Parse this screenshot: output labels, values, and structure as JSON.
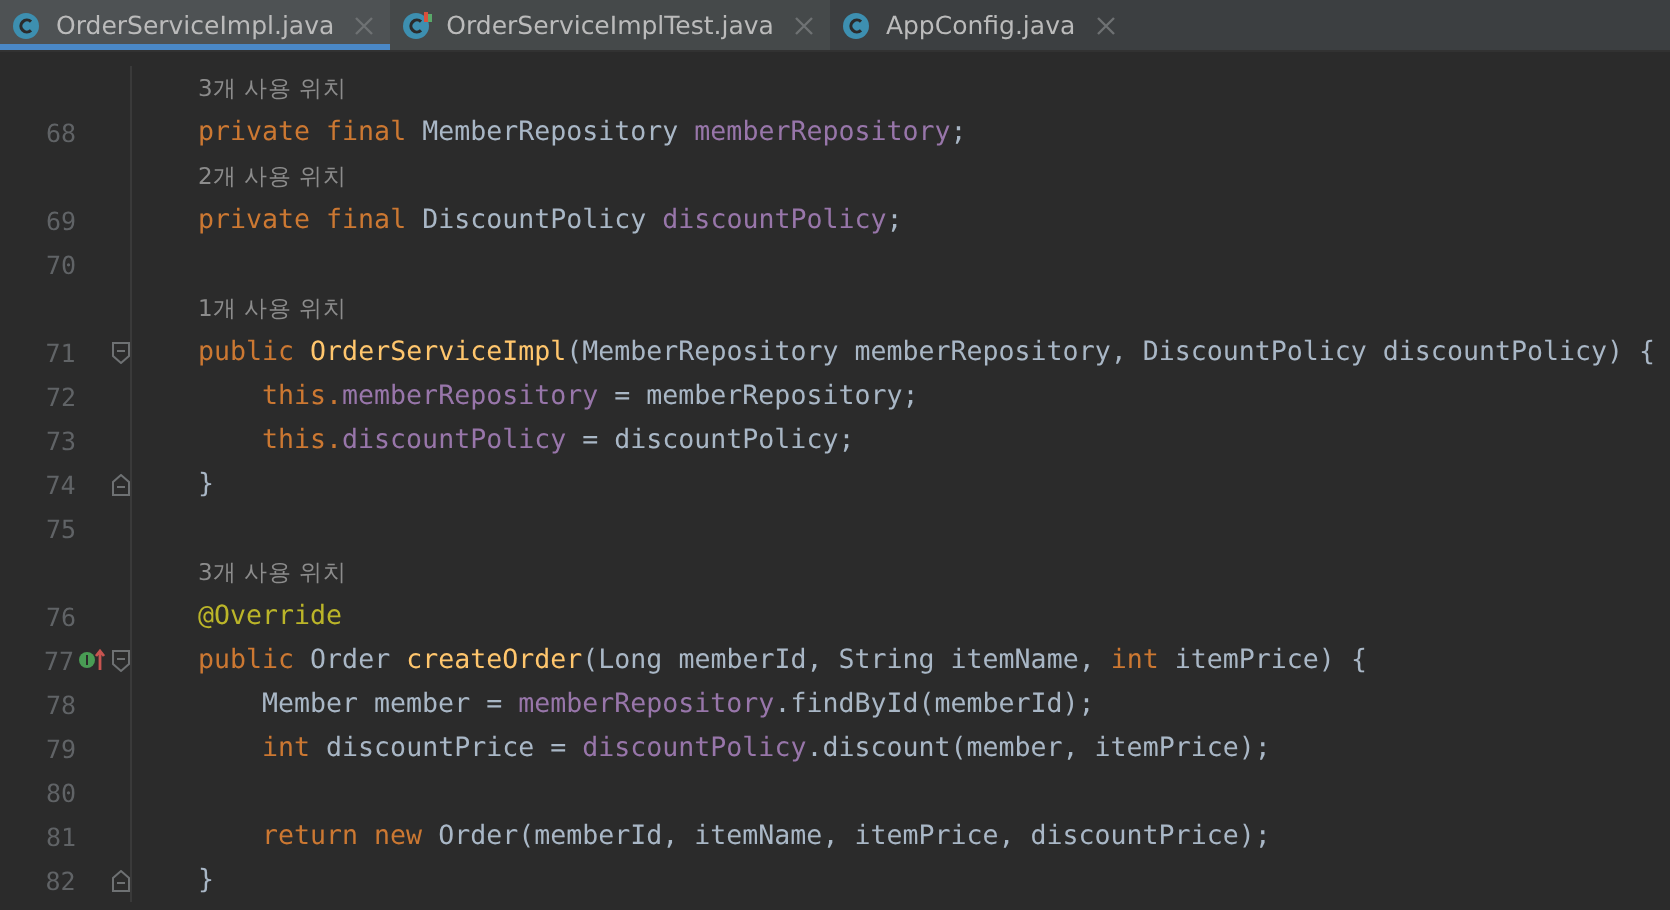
{
  "tabs": [
    {
      "label": "OrderServiceImpl.java",
      "selected": true,
      "kind": "class"
    },
    {
      "label": "OrderServiceImplTest.java",
      "selected": false,
      "kind": "test"
    },
    {
      "label": "AppConfig.java",
      "selected": false,
      "kind": "class"
    }
  ],
  "lines": [
    {
      "kind": "hint",
      "text": "3개 사용 위치"
    },
    {
      "kind": "code",
      "number": "68",
      "parts": [
        {
          "kind": "keyword",
          "text": "private final "
        },
        {
          "kind": "plain",
          "text": "MemberRepository "
        },
        {
          "kind": "field",
          "text": "memberRepository"
        },
        {
          "kind": "plain",
          "text": ";"
        }
      ]
    },
    {
      "kind": "hint",
      "text": "2개 사용 위치"
    },
    {
      "kind": "code",
      "number": "69",
      "parts": [
        {
          "kind": "keyword",
          "text": "private final "
        },
        {
          "kind": "plain",
          "text": "DiscountPolicy "
        },
        {
          "kind": "field",
          "text": "discountPolicy"
        },
        {
          "kind": "plain",
          "text": ";"
        }
      ]
    },
    {
      "kind": "code",
      "number": "70"
    },
    {
      "kind": "hint",
      "text": "1개 사용 위치"
    },
    {
      "kind": "code",
      "number": "71",
      "fold_start": true,
      "parts": [
        {
          "kind": "keyword",
          "text": "public "
        },
        {
          "kind": "declaration",
          "text": "OrderServiceImpl"
        },
        {
          "kind": "plain",
          "text": "(MemberRepository memberRepository, DiscountPolicy discountPolicy) {"
        }
      ]
    },
    {
      "kind": "code",
      "number": "72",
      "indented": true,
      "parts": [
        {
          "kind": "keyword",
          "text": "this."
        },
        {
          "kind": "field",
          "text": "memberRepository"
        },
        {
          "kind": "plain",
          "text": " = memberRepository;"
        }
      ]
    },
    {
      "kind": "code",
      "number": "73",
      "indented": true,
      "parts": [
        {
          "kind": "keyword",
          "text": "this."
        },
        {
          "kind": "field",
          "text": "discountPolicy"
        },
        {
          "kind": "plain",
          "text": " = discountPolicy;"
        }
      ]
    },
    {
      "kind": "code",
      "number": "74",
      "fold_end": true,
      "parts": [
        {
          "kind": "plain",
          "text": "}"
        }
      ]
    },
    {
      "kind": "code",
      "number": "75"
    },
    {
      "kind": "hint",
      "text": "3개 사용 위치"
    },
    {
      "kind": "code",
      "number": "76",
      "parts": [
        {
          "kind": "annotation",
          "text": "@Override"
        }
      ]
    },
    {
      "kind": "code",
      "number": "77",
      "fold_start": true,
      "implements_marker": true,
      "parts": [
        {
          "kind": "keyword",
          "text": "public "
        },
        {
          "kind": "plain",
          "text": "Order "
        },
        {
          "kind": "declaration",
          "text": "createOrder"
        },
        {
          "kind": "plain",
          "text": "(Long memberId, String itemName, "
        },
        {
          "kind": "keyword",
          "text": "int"
        },
        {
          "kind": "plain",
          "text": " itemPrice) {"
        }
      ]
    },
    {
      "kind": "code",
      "number": "78",
      "indented": true,
      "parts": [
        {
          "kind": "plain",
          "text": "Member member = "
        },
        {
          "kind": "field",
          "text": "memberRepository"
        },
        {
          "kind": "plain",
          "text": ".findById(memberId);"
        }
      ]
    },
    {
      "kind": "code",
      "number": "79",
      "indented": true,
      "parts": [
        {
          "kind": "keyword",
          "text": "int"
        },
        {
          "kind": "plain",
          "text": " discountPrice = "
        },
        {
          "kind": "field",
          "text": "discountPolicy"
        },
        {
          "kind": "plain",
          "text": ".discount(member, itemPrice);"
        }
      ]
    },
    {
      "kind": "code",
      "number": "80"
    },
    {
      "kind": "code",
      "number": "81",
      "indented": true,
      "parts": [
        {
          "kind": "keyword",
          "text": "return new "
        },
        {
          "kind": "plain",
          "text": "Order(memberId, itemName, itemPrice, discountPrice);"
        }
      ]
    },
    {
      "kind": "code",
      "number": "82",
      "fold_end": true,
      "parts": [
        {
          "kind": "plain",
          "text": "}"
        }
      ]
    }
  ]
}
